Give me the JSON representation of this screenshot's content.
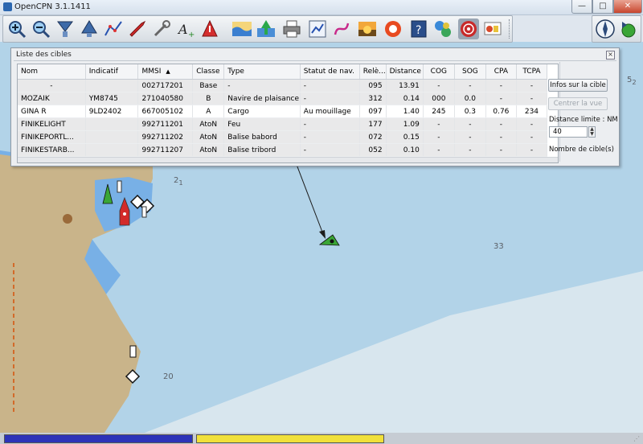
{
  "window": {
    "title": "OpenCPN 3.1.1411",
    "minimize_icon": "minimize-icon",
    "maximize_icon": "maximize-icon",
    "close_icon": "close-icon",
    "minimize_glyph": "—",
    "maximize_glyph": "□",
    "close_glyph": "✕"
  },
  "toolbar": {
    "buttons": [
      {
        "name": "zoom-in-icon"
      },
      {
        "name": "zoom-out-icon"
      },
      {
        "name": "scale-in-icon"
      },
      {
        "name": "scale-out-icon"
      },
      {
        "name": "route-icon"
      },
      {
        "name": "auto-follow-icon"
      },
      {
        "name": "settings-icon"
      },
      {
        "name": "text-icon"
      },
      {
        "name": "current-icon"
      },
      {
        "name": "tide-icon"
      },
      {
        "name": "chart-overlay-icon"
      },
      {
        "name": "print-icon"
      },
      {
        "name": "route-manager-icon"
      },
      {
        "name": "track-icon"
      },
      {
        "name": "color-scheme-icon"
      },
      {
        "name": "mob-icon"
      },
      {
        "name": "help-icon"
      },
      {
        "name": "plugin-icon"
      },
      {
        "name": "ais-icon"
      },
      {
        "name": "dashboard-icon"
      }
    ],
    "secondary": [
      {
        "name": "compass-icon"
      },
      {
        "name": "gps-status-icon"
      }
    ]
  },
  "chart": {
    "depths": [
      {
        "label": "5",
        "sub": "2"
      },
      {
        "label": "2",
        "sub": "1"
      },
      {
        "label": "33",
        "sub": ""
      },
      {
        "label": "20",
        "sub": ""
      }
    ],
    "colors": {
      "land": "#c9b48a",
      "shallow": "#78b0e6",
      "medium": "#b2d3e8",
      "deep": "#d8e6ee",
      "target": "#3aa636"
    }
  },
  "dialog": {
    "title": "Liste des cibles",
    "columns": [
      "Nom",
      "Indicatif",
      "MMSI",
      "Classe",
      "Type",
      "Statut de nav.",
      "Relè...",
      "Distance",
      "COG",
      "SOG",
      "CPA",
      "TCPA"
    ],
    "sort_indicator": "▲",
    "rows": [
      [
        "-",
        "",
        "002717201",
        "Base",
        "-",
        "-",
        "095",
        "13.91",
        "-",
        "-",
        "-",
        "-"
      ],
      [
        "MOZAIK",
        "YM8745",
        "271040580",
        "B",
        "Navire de plaisance",
        "-",
        "312",
        "0.14",
        "000",
        "0.0",
        "-",
        "-"
      ],
      [
        "GINA R",
        "9LD2402",
        "667005102",
        "A",
        "Cargo",
        "Au mouillage",
        "097",
        "1.40",
        "245",
        "0.3",
        "0.76",
        "234"
      ],
      [
        "FINIKELIGHT",
        "",
        "992711201",
        "AtoN",
        "Feu",
        "-",
        "177",
        "1.09",
        "-",
        "-",
        "-",
        "-"
      ],
      [
        "FINIKEPORTL...",
        "",
        "992711202",
        "AtoN",
        "Balise babord",
        "-",
        "072",
        "0.15",
        "-",
        "-",
        "-",
        "-"
      ],
      [
        "FINIKESTARB...",
        "",
        "992711207",
        "AtoN",
        "Balise tribord",
        "-",
        "052",
        "0.10",
        "-",
        "-",
        "-",
        "-"
      ]
    ],
    "info_button": "Infos sur la cible",
    "center_button": "Centrer la vue",
    "distance_label": "Distance limite : NM",
    "distance_value": "40",
    "count_label": "Nombre de cible(s)"
  },
  "statusbar": {
    "left_color": "#2d33b8",
    "right_color": "#f1e03a"
  }
}
